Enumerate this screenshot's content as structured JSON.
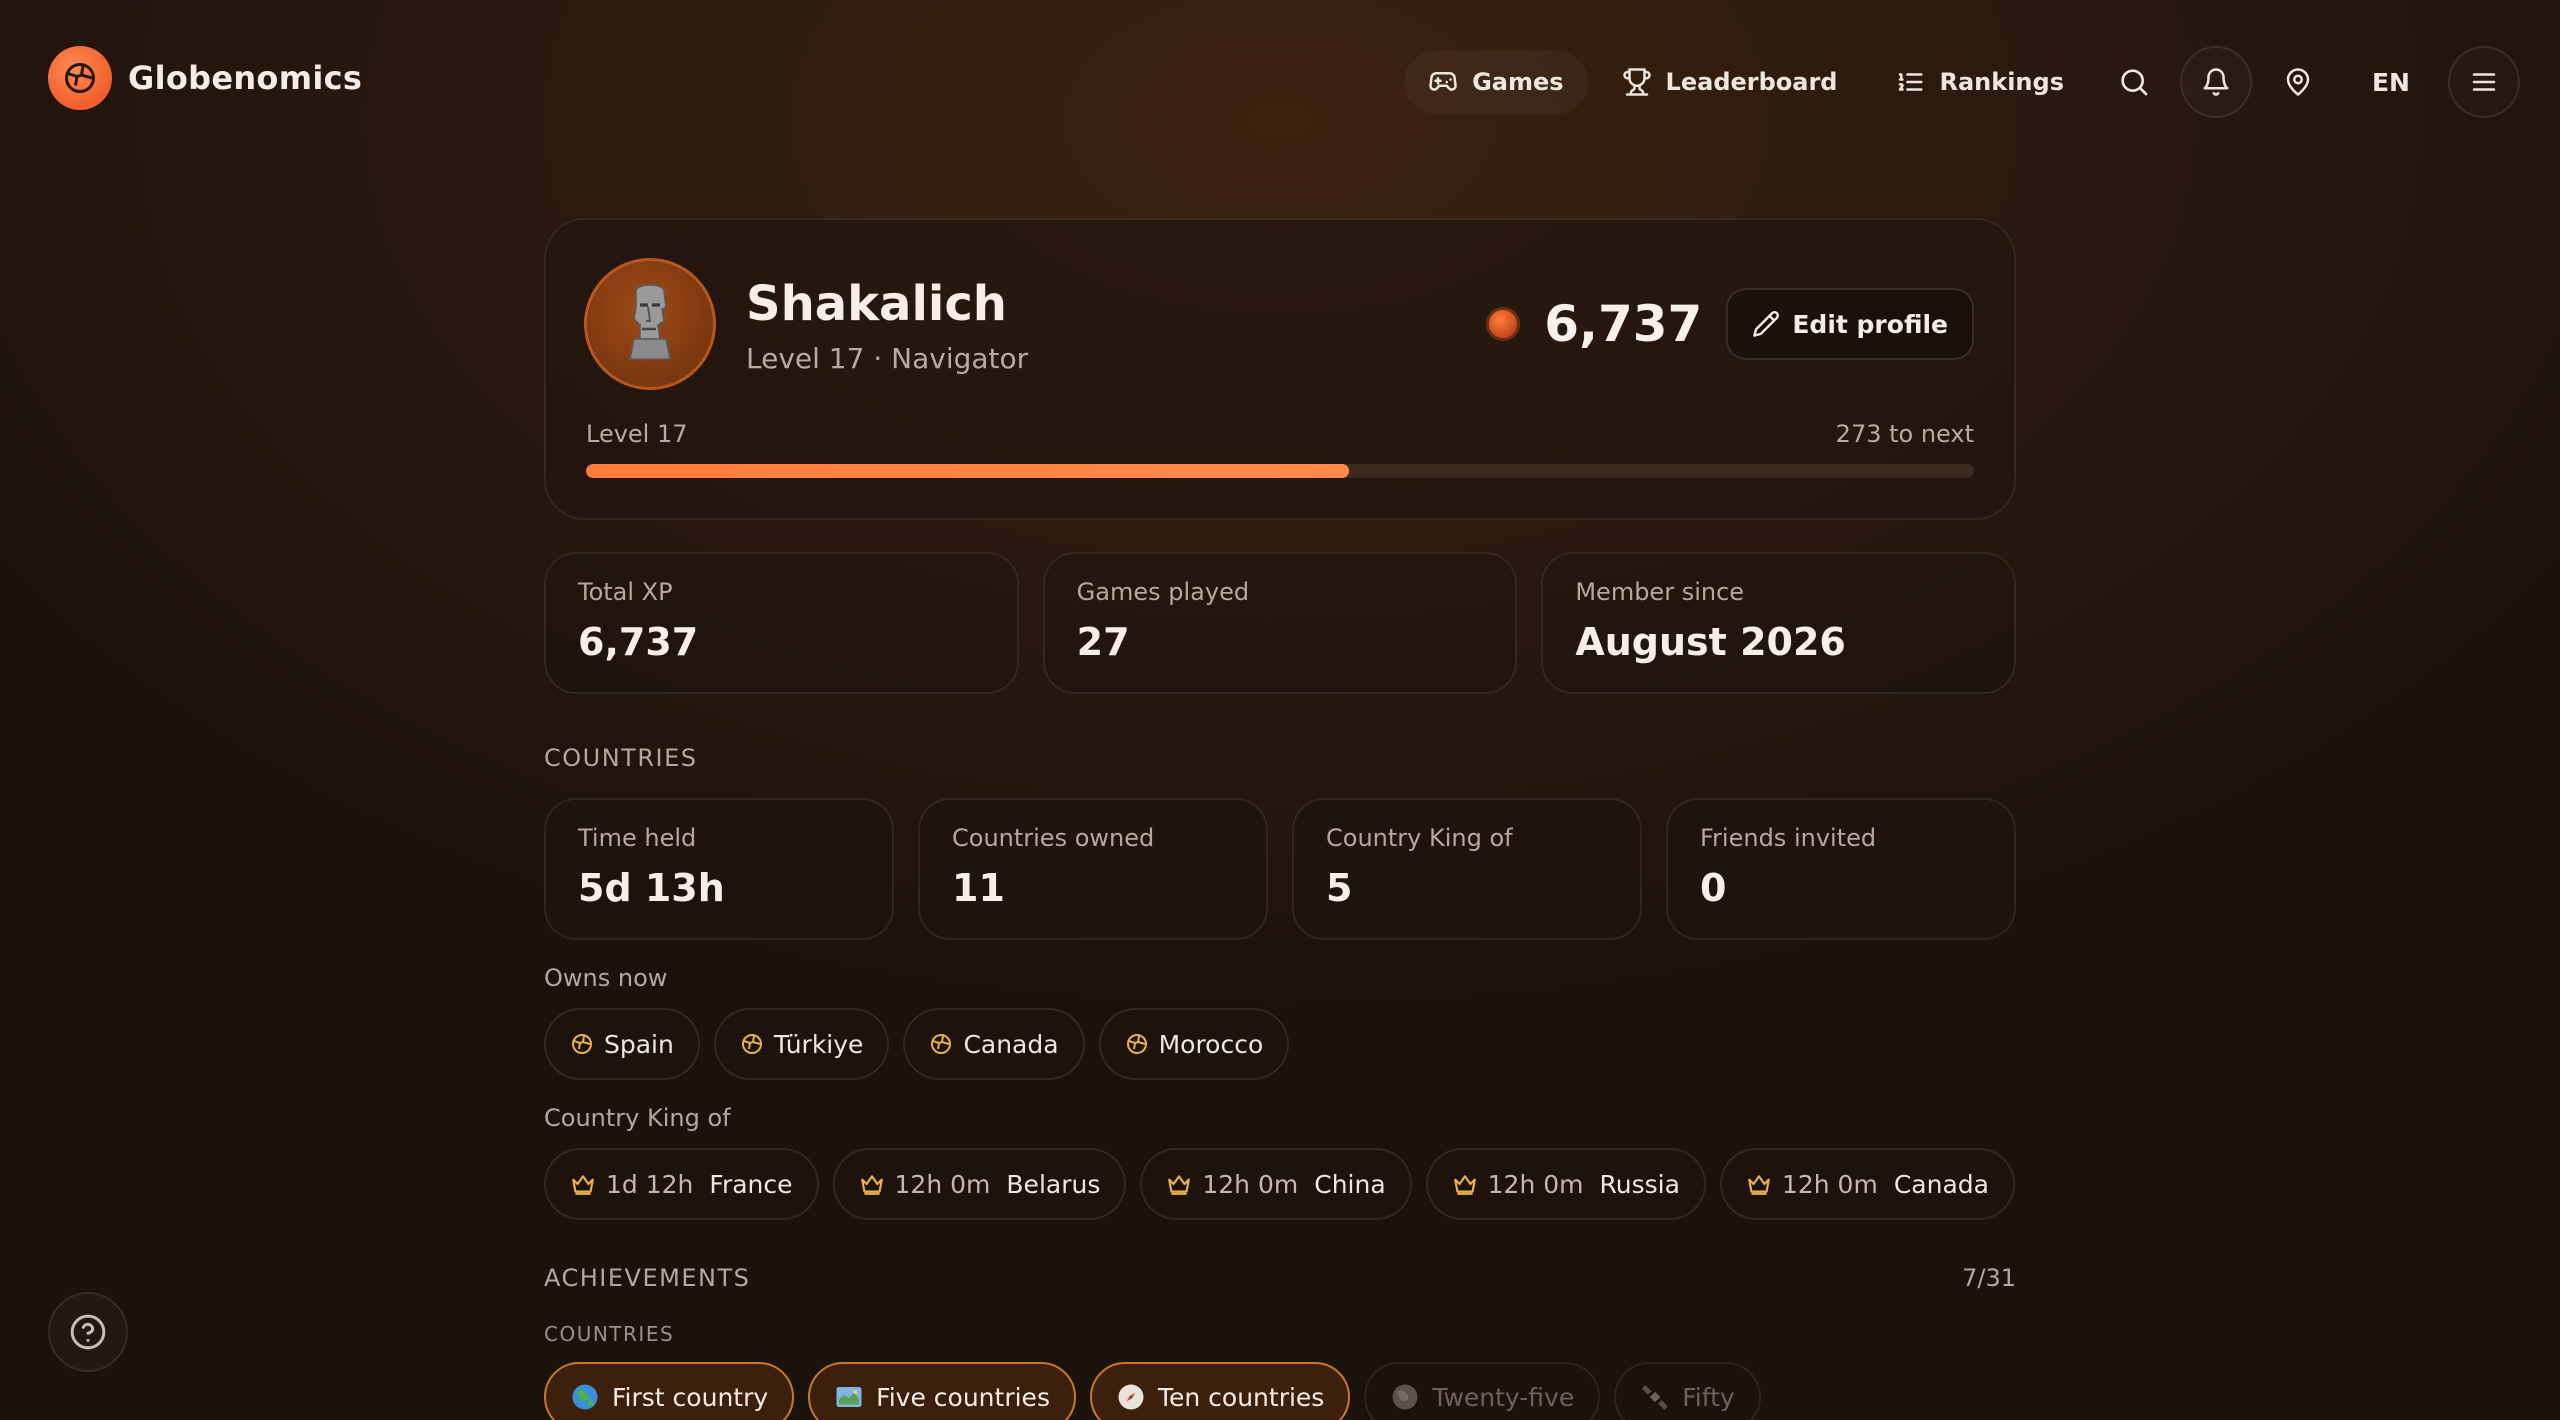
{
  "brand": {
    "name": "Globenomics"
  },
  "nav": {
    "games": "Games",
    "leaderboard": "Leaderboard",
    "rankings": "Rankings",
    "language": "EN"
  },
  "profile": {
    "name": "Shakalich",
    "subtitle": "Level 17 · Navigator",
    "xp": "6,737",
    "edit_label": "Edit profile",
    "level_label": "Level 17",
    "to_next": "273 to next",
    "progress_fraction": 0.55
  },
  "stats": [
    {
      "label": "Total XP",
      "value": "6,737"
    },
    {
      "label": "Games played",
      "value": "27"
    },
    {
      "label": "Member since",
      "value": "August 2026"
    }
  ],
  "countries": {
    "title": "COUNTRIES",
    "stats": [
      {
        "label": "Time held",
        "value": "5d 13h"
      },
      {
        "label": "Countries owned",
        "value": "11"
      },
      {
        "label": "Country King of",
        "value": "5"
      },
      {
        "label": "Friends invited",
        "value": "0"
      }
    ],
    "owns_title": "Owns now",
    "owns": [
      "Spain",
      "Türkiye",
      "Canada",
      "Morocco"
    ],
    "king_title": "Country King of",
    "kings": [
      {
        "time": "1d 12h",
        "country": "France"
      },
      {
        "time": "12h 0m",
        "country": "Belarus"
      },
      {
        "time": "12h 0m",
        "country": "China"
      },
      {
        "time": "12h 0m",
        "country": "Russia"
      },
      {
        "time": "12h 0m",
        "country": "Canada"
      }
    ]
  },
  "achievements": {
    "title": "ACHIEVEMENTS",
    "count": "7/31",
    "group": "COUNTRIES",
    "items": [
      {
        "label": "First country",
        "unlocked": true,
        "icon": "globe-icon"
      },
      {
        "label": "Five countries",
        "unlocked": true,
        "icon": "map-icon"
      },
      {
        "label": "Ten countries",
        "unlocked": true,
        "icon": "compass-icon"
      },
      {
        "label": "Twenty-five",
        "unlocked": false,
        "icon": "globe-icon"
      },
      {
        "label": "Fifty",
        "unlocked": false,
        "icon": "satellite-icon"
      }
    ]
  },
  "colors": {
    "accent": "#ff7c3c",
    "gold": "#e8b34a"
  }
}
